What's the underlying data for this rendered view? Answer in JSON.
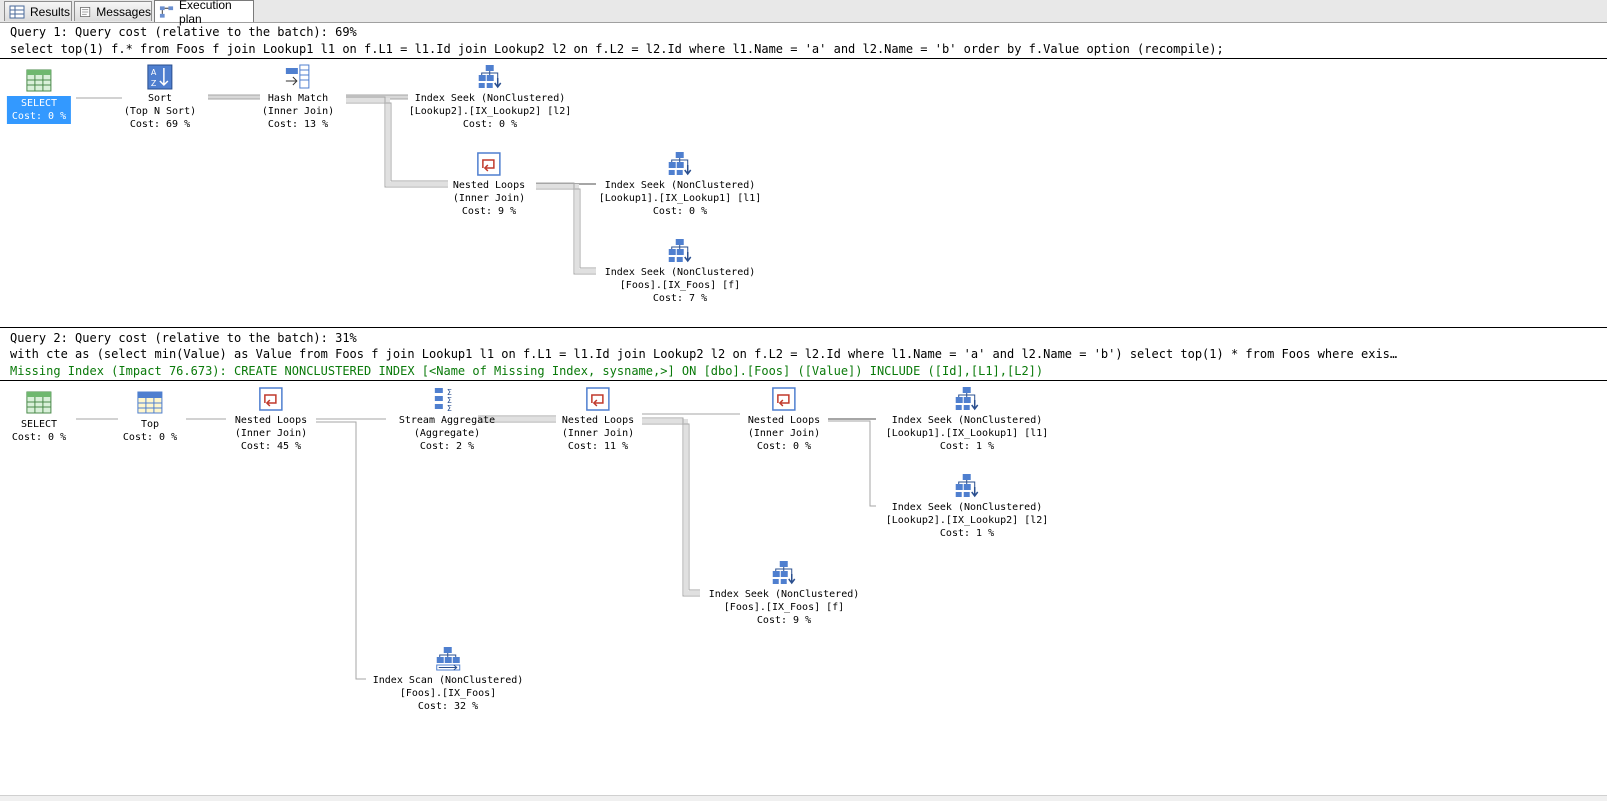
{
  "tabs": [
    {
      "label": "Results",
      "icon": "results-grid-icon"
    },
    {
      "label": "Messages",
      "icon": "messages-icon"
    },
    {
      "label": "Execution plan",
      "icon": "execution-plan-icon",
      "active": true
    }
  ],
  "query1": {
    "header": "Query 1: Query cost (relative to the batch): 69%",
    "sql": "select top(1) f.* from Foos f join Lookup1 l1 on f.L1 = l1.Id join Lookup2 l2 on f.L2 = l2.Id where l1.Name = 'a' and l2.Name = 'b' order by f.Value option (recompile);",
    "nodes": {
      "select": {
        "l1": "SELECT",
        "l2": "Cost: 0 %"
      },
      "sort": {
        "l1": "Sort",
        "l2": "(Top N Sort)",
        "l3": "Cost: 69 %"
      },
      "hash": {
        "l1": "Hash Match",
        "l2": "(Inner Join)",
        "l3": "Cost: 13 %"
      },
      "seek_l2": {
        "l1": "Index Seek (NonClustered)",
        "l2": "[Lookup2].[IX_Lookup2] [l2]",
        "l3": "Cost: 0 %"
      },
      "nested": {
        "l1": "Nested Loops",
        "l2": "(Inner Join)",
        "l3": "Cost: 9 %"
      },
      "seek_l1": {
        "l1": "Index Seek (NonClustered)",
        "l2": "[Lookup1].[IX_Lookup1] [l1]",
        "l3": "Cost: 0 %"
      },
      "seek_f": {
        "l1": "Index Seek (NonClustered)",
        "l2": "[Foos].[IX_Foos] [f]",
        "l3": "Cost: 7 %"
      }
    }
  },
  "query2": {
    "header": "Query 2: Query cost (relative to the batch): 31%",
    "sql": "with cte as (select min(Value) as Value from Foos f join Lookup1 l1 on f.L1 = l1.Id join Lookup2 l2 on f.L2 = l2.Id where l1.Name = 'a' and l2.Name = 'b') select top(1) * from Foos where exis…",
    "missing_index": "Missing Index (Impact 76.673): CREATE NONCLUSTERED INDEX [<Name of Missing Index, sysname,>] ON [dbo].[Foos] ([Value]) INCLUDE ([Id],[L1],[L2])",
    "nodes": {
      "select": {
        "l1": "SELECT",
        "l2": "Cost: 0 %"
      },
      "top": {
        "l1": "Top",
        "l2": "Cost: 0 %"
      },
      "nl_a": {
        "l1": "Nested Loops",
        "l2": "(Inner Join)",
        "l3": "Cost: 45 %"
      },
      "agg": {
        "l1": "Stream Aggregate",
        "l2": "(Aggregate)",
        "l3": "Cost: 2 %"
      },
      "nl_b": {
        "l1": "Nested Loops",
        "l2": "(Inner Join)",
        "l3": "Cost: 11 %"
      },
      "nl_c": {
        "l1": "Nested Loops",
        "l2": "(Inner Join)",
        "l3": "Cost: 0 %"
      },
      "seek_l1": {
        "l1": "Index Seek (NonClustered)",
        "l2": "[Lookup1].[IX_Lookup1] [l1]",
        "l3": "Cost: 1 %"
      },
      "seek_l2": {
        "l1": "Index Seek (NonClustered)",
        "l2": "[Lookup2].[IX_Lookup2] [l2]",
        "l3": "Cost: 1 %"
      },
      "seek_f": {
        "l1": "Index Seek (NonClustered)",
        "l2": "[Foos].[IX_Foos] [f]",
        "l3": "Cost: 9 %"
      },
      "scan": {
        "l1": "Index Scan (NonClustered)",
        "l2": "[Foos].[IX_Foos]",
        "l3": "Cost: 32 %"
      }
    }
  }
}
